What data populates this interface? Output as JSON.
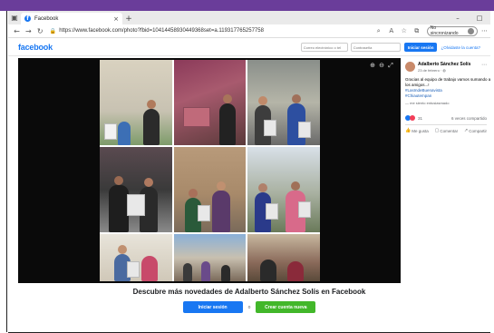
{
  "browser": {
    "tab_title": "Facebook",
    "tab_close": "×",
    "new_tab": "+",
    "minimize": "–",
    "restore": "□",
    "url": "https://www.facebook.com/photo?fbid=10414458930449368set=a.119317765257758",
    "incognito_label": "No sincronizando"
  },
  "fb": {
    "logo": "facebook",
    "email_placeholder": "Correo electrónico o tel",
    "password_placeholder": "Contraseña",
    "login_button": "Iniciar sesión",
    "forgot": "¿Olvidaste la cuenta?"
  },
  "post": {
    "author": "Adalberto Sánchez Solís",
    "date": "23 de febrero · ",
    "text_lines": [
      "Gracias al equipo de trabajo vamos sumando a",
      "los amigos...!",
      "#LasIndeBuenavista",
      "#Chiautempan"
    ],
    "translate": "— me siento entusiasmado",
    "reaction_count": "31",
    "shares": "6 veces compartido",
    "like_label": "Me gusta",
    "comment_label": "Comentar",
    "share_label": "Compartir"
  },
  "bottom": {
    "title": "Descubre más novedades de Adalberto Sánchez Solís en Facebook",
    "login": "Iniciar sesión",
    "separator": "o",
    "create": "Crear cuenta nueva"
  },
  "colors": {
    "brand": "#1877f2",
    "create": "#42b72a",
    "top_band": "#6a3d9a"
  },
  "icons": {
    "zoom_in": "zoom-in-icon",
    "zoom_out": "zoom-out-icon",
    "fullscreen": "fullscreen-icon"
  }
}
